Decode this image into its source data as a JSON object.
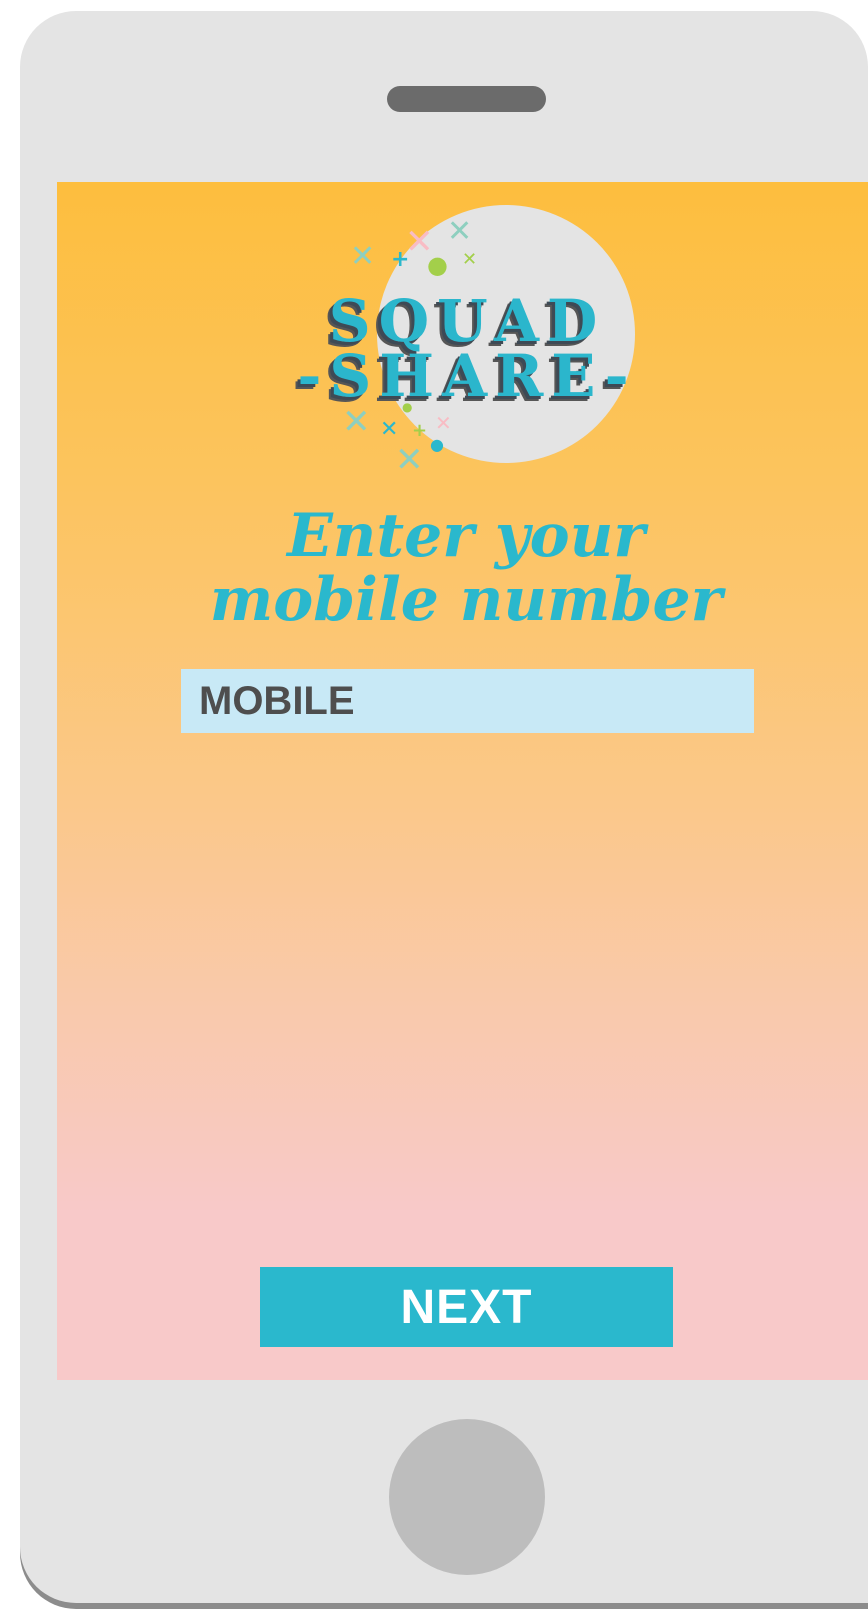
{
  "logo": {
    "line1": "SQUAD",
    "line2": "-SHARE-"
  },
  "heading": {
    "line1": "Enter your",
    "line2": "mobile number"
  },
  "mobile_field": {
    "placeholder": "MOBILE"
  },
  "next_button": {
    "label": "NEXT"
  },
  "colors": {
    "accent": "#2ab8cd",
    "gradient_top": "#fdbe3e",
    "gradient_bottom": "#f8c9c9",
    "input_bg": "#c8e9f6",
    "phone_body": "#e4e4e4"
  }
}
